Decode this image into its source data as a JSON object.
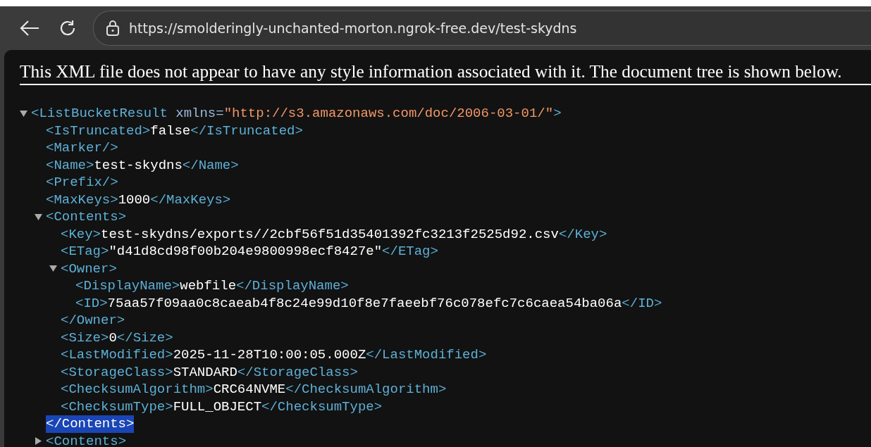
{
  "browser": {
    "url": "https://smolderingly-unchanted-morton.ngrok-free.dev/test-skydns"
  },
  "notice": "This XML file does not appear to have any style information associated with it. The document tree is shown below.",
  "tree": [
    {
      "kind": "parent",
      "open": "<ListBucketResult",
      "attrs": [
        {
          "name": "xmlns=",
          "value": "\"http://s3.amazonaws.com/doc/2006-03-01/\""
        }
      ],
      "open_end": ">",
      "expanded": true,
      "children": [
        {
          "kind": "leaf",
          "open": "<IsTruncated>",
          "value": "false",
          "close": "</IsTruncated>"
        },
        {
          "kind": "leaf",
          "open": "<Marker/>"
        },
        {
          "kind": "leaf",
          "open": "<Name>",
          "value": "test-skydns",
          "close": "</Name>"
        },
        {
          "kind": "leaf",
          "open": "<Prefix/>"
        },
        {
          "kind": "leaf",
          "open": "<MaxKeys>",
          "value": "1000",
          "close": "</MaxKeys>"
        },
        {
          "kind": "parent",
          "open": "<Contents",
          "open_end": ">",
          "expanded": true,
          "close": "</Contents>",
          "close_selected": true,
          "children": [
            {
              "kind": "leaf",
              "open": "<Key>",
              "value": "test-skydns/exports//2cbf56f51d35401392fc3213f2525d92.csv",
              "close": "</Key>"
            },
            {
              "kind": "leaf",
              "open": "<ETag>",
              "value": "\"d41d8cd98f00b204e9800998ecf8427e\"",
              "close": "</ETag>"
            },
            {
              "kind": "parent",
              "open": "<Owner",
              "open_end": ">",
              "expanded": true,
              "close": "</Owner>",
              "close_selected": false,
              "children": [
                {
                  "kind": "leaf",
                  "open": "<DisplayName>",
                  "value": "webfile",
                  "close": "</DisplayName>"
                },
                {
                  "kind": "leaf",
                  "open": "<ID>",
                  "value": "75aa57f09aa0c8caeab4f8c24e99d10f8e7faeebf76c078efc7c6caea54ba06a",
                  "close": "</ID>"
                }
              ]
            },
            {
              "kind": "leaf",
              "open": "<Size>",
              "value": "0",
              "close": "</Size>"
            },
            {
              "kind": "leaf",
              "open": "<LastModified>",
              "value": "2025-11-28T10:00:05.000Z",
              "close": "</LastModified>"
            },
            {
              "kind": "leaf",
              "open": "<StorageClass>",
              "value": "STANDARD",
              "close": "</StorageClass>"
            },
            {
              "kind": "leaf",
              "open": "<ChecksumAlgorithm>",
              "value": "CRC64NVME",
              "close": "</ChecksumAlgorithm>"
            },
            {
              "kind": "leaf",
              "open": "<ChecksumType>",
              "value": "FULL_OBJECT",
              "close": "</ChecksumType>"
            }
          ]
        },
        {
          "kind": "parent",
          "open": "<Contents",
          "open_end": ">",
          "expanded": false
        }
      ]
    }
  ]
}
